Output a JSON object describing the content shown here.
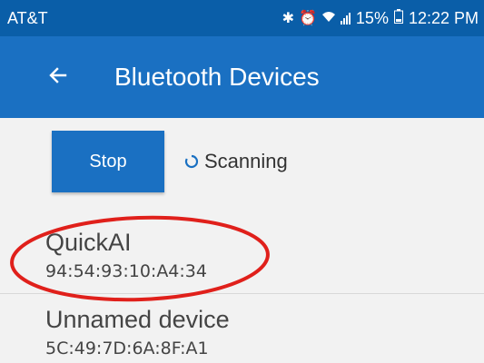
{
  "status_bar": {
    "carrier": "AT&T",
    "battery_percent": "15%",
    "time": "12:22 PM",
    "icons": [
      "bluetooth-icon",
      "alarm-icon",
      "wifi-icon",
      "signal-icon",
      "battery-icon"
    ]
  },
  "app_bar": {
    "title": "Bluetooth Devices",
    "back_icon": "arrow-left-icon"
  },
  "controls": {
    "stop_label": "Stop",
    "scanning_label": "Scanning",
    "scanning_icon": "spinner-icon"
  },
  "devices": [
    {
      "name": "QuickAI",
      "address": "94:54:93:10:A4:34"
    },
    {
      "name": "Unnamed device",
      "address": "5C:49:7D:6A:8F:A1"
    }
  ],
  "colors": {
    "status_bar": "#0a5ea8",
    "app_bar": "#1a70c2",
    "accent": "#1a70c2",
    "annotation": "#e0201b",
    "background": "#f2f2f2"
  }
}
